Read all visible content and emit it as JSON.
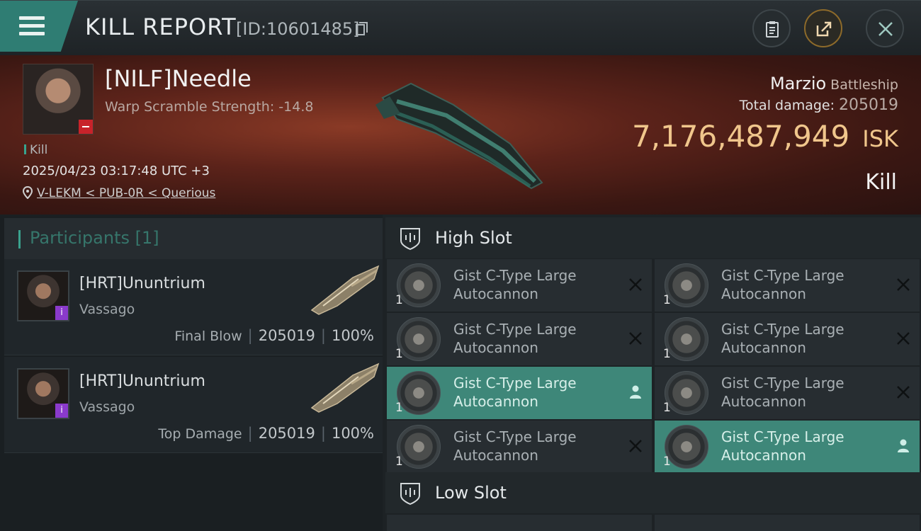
{
  "header": {
    "title": "KILL REPORT",
    "report_id": "[ID:10601485]"
  },
  "victim": {
    "pilot": "[NILF]Needle",
    "detail": "Warp Scramble Strength: -14.8",
    "tag": "Kill",
    "datetime": "2025/04/23 03:17:48 UTC +3",
    "location": "V-LEKM < PUB-0R < Querious",
    "ship": "Marzio",
    "ship_class": "Battleship",
    "damage_label": "Total damage:",
    "damage": "205019",
    "isk_value": "7,176,487,949",
    "isk_unit": "ISK",
    "type": "Kill"
  },
  "participants": {
    "label": "Participants [1]",
    "rows": [
      {
        "name": "[HRT]Ununtrium",
        "ship": "Vassago",
        "role": "Final Blow",
        "damage": "205019",
        "percent": "100%"
      },
      {
        "name": "[HRT]Ununtrium",
        "ship": "Vassago",
        "role": "Top Damage",
        "damage": "205019",
        "percent": "100%"
      }
    ]
  },
  "fitting": {
    "high_slot_label": "High Slot",
    "low_slot_label": "Low Slot",
    "modules": [
      {
        "line1": "Gist C-Type Large",
        "line2": "Autocannon",
        "qty": "1",
        "state": "destroyed"
      },
      {
        "line1": "Gist C-Type Large",
        "line2": "Autocannon",
        "qty": "1",
        "state": "destroyed"
      },
      {
        "line1": "Gist C-Type Large",
        "line2": "Autocannon",
        "qty": "1",
        "state": "destroyed"
      },
      {
        "line1": "Gist C-Type Large",
        "line2": "Autocannon",
        "qty": "1",
        "state": "destroyed"
      },
      {
        "line1": "Gist C-Type Large",
        "line2": "Autocannon",
        "qty": "1",
        "state": "dropped"
      },
      {
        "line1": "Gist C-Type Large",
        "line2": "Autocannon",
        "qty": "1",
        "state": "destroyed"
      },
      {
        "line1": "Gist C-Type Large",
        "line2": "Autocannon",
        "qty": "1",
        "state": "destroyed"
      },
      {
        "line1": "Gist C-Type Large",
        "line2": "Autocannon",
        "qty": "1",
        "state": "dropped"
      }
    ]
  },
  "colors": {
    "accent_teal": "#3e8779",
    "isk_gold": "#f0c68c",
    "banner_red": "#5c231a"
  },
  "icons": {
    "menu": "menu-icon",
    "copy": "copy-icon",
    "clipboard": "clipboard-icon",
    "share": "share-icon",
    "close": "close-icon",
    "pin": "location-pin-icon",
    "slot": "slot-shield-icon",
    "destroyed": "x-icon",
    "dropped": "person-icon"
  }
}
